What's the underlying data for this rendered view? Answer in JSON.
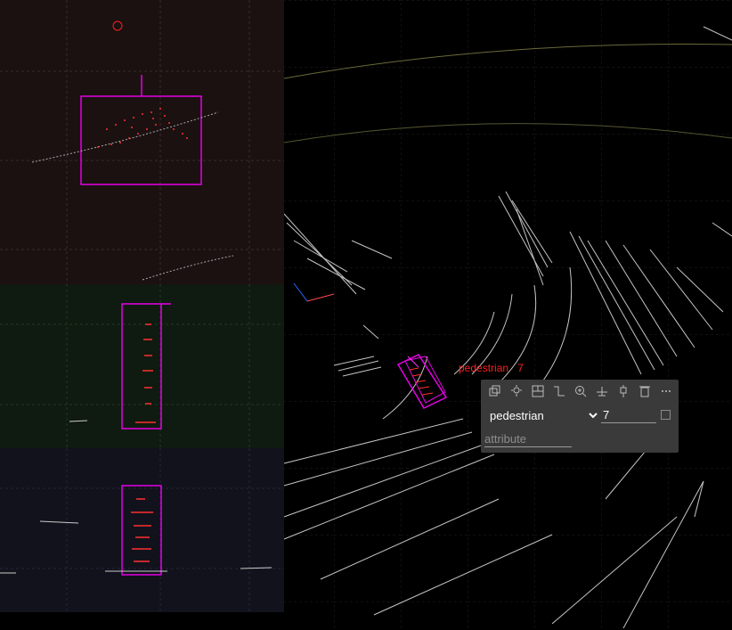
{
  "scene": {
    "label_color": "#ff1f1f",
    "box_color": "#e600e6",
    "point_color": "#e8e8e8",
    "object_point_color": "#ff2020",
    "selected_label": {
      "class": "pedestrian",
      "track_id": "7"
    }
  },
  "views": {
    "top": {
      "name": "top-view",
      "background": "#1b1111"
    },
    "front": {
      "name": "front-view",
      "background": "#0f1a10"
    },
    "side": {
      "name": "side-view",
      "background": "#11121c"
    }
  },
  "toolbar": {
    "icons": [
      "copy-icon",
      "highlight-icon",
      "fit-box-icon",
      "path-icon",
      "zoom-in-icon",
      "align-ground-icon",
      "pin-icon",
      "delete-icon",
      "more-icon"
    ],
    "class_value": "pedestrian",
    "class_options": [
      "pedestrian"
    ],
    "track_id_value": "7",
    "attribute_placeholder": "attribute"
  }
}
